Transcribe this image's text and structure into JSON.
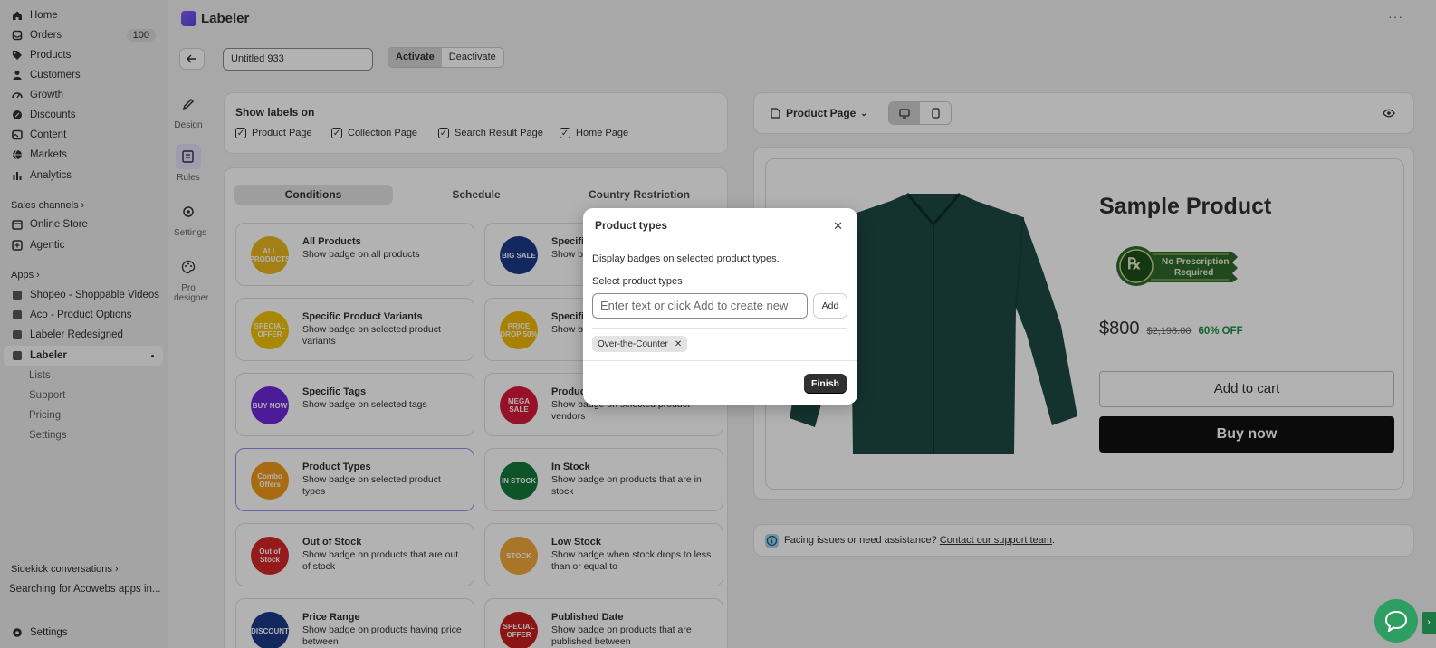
{
  "sidebar": {
    "items": [
      {
        "label": "Home",
        "icon": "home-icon"
      },
      {
        "label": "Orders",
        "icon": "orders-icon",
        "badge": "100"
      },
      {
        "label": "Products",
        "icon": "tag-icon"
      },
      {
        "label": "Customers",
        "icon": "person-icon"
      },
      {
        "label": "Growth",
        "icon": "gauge-icon"
      },
      {
        "label": "Discounts",
        "icon": "discount-icon"
      },
      {
        "label": "Content",
        "icon": "content-icon"
      },
      {
        "label": "Markets",
        "icon": "globe-icon"
      },
      {
        "label": "Analytics",
        "icon": "bar-chart-icon"
      }
    ],
    "sales_channels_label": "Sales channels",
    "channels": [
      {
        "label": "Online Store",
        "icon": "store-icon"
      },
      {
        "label": "Agentic",
        "icon": "agentic-icon"
      }
    ],
    "apps_label": "Apps",
    "apps": [
      {
        "label": "Shopeo - Shoppable Videos",
        "icon": "app-icon"
      },
      {
        "label": "Aco - Product Options",
        "icon": "app-icon"
      },
      {
        "label": "Labeler Redesigned",
        "icon": "app-icon"
      },
      {
        "label": "Labeler",
        "icon": "app-icon"
      }
    ],
    "labeler_sub": [
      "Lists",
      "Support",
      "Pricing",
      "Settings"
    ],
    "sidekick_label": "Sidekick conversations",
    "sidekick_item": "Searching for Acowebs apps in...",
    "settings_label": "Settings"
  },
  "header": {
    "app_title": "Labeler",
    "label_name": "Untitled 933",
    "activate_label": "Activate",
    "deactivate_label": "Deactivate"
  },
  "rail": [
    {
      "label": "Design",
      "icon": "pencil-icon"
    },
    {
      "label": "Rules",
      "icon": "rules-icon"
    },
    {
      "label": "Settings",
      "icon": "gear-icon"
    },
    {
      "label": "Pro designer",
      "icon": "palette-icon"
    }
  ],
  "show_labels": {
    "title": "Show labels on",
    "options": [
      "Product Page",
      "Collection Page",
      "Search Result Page",
      "Home Page"
    ]
  },
  "tabs": [
    "Conditions",
    "Schedule",
    "Country Restriction"
  ],
  "conditions": [
    {
      "title": "All Products",
      "desc": "Show badge on all products",
      "art": "ALL PRODUCTS",
      "color": "#e8b820"
    },
    {
      "title": "Specific Products",
      "desc": "Show badge on selected products",
      "art": "BIG SALE",
      "color": "#1e3a8a"
    },
    {
      "title": "Specific Product Variants",
      "desc": "Show badge on selected product variants",
      "art": "SPECIAL OFFER",
      "color": "#f2c200"
    },
    {
      "title": "Specific Collections",
      "desc": "Show badge on selected collections",
      "art": "PRICE DROP 50%",
      "color": "#f3b800"
    },
    {
      "title": "Specific Tags",
      "desc": "Show badge on selected tags",
      "art": "BUY NOW",
      "color": "#6d28d9"
    },
    {
      "title": "Product Vendors",
      "desc": "Show badge on selected product vendors",
      "art": "MEGA SALE",
      "color": "#d81b3a"
    },
    {
      "title": "Product Types",
      "desc": "Show badge on selected product types",
      "art": "Combo Offers",
      "color": "#f29a1a"
    },
    {
      "title": "In Stock",
      "desc": "Show badge on products that are in stock",
      "art": "IN STOCK",
      "color": "#137a3c"
    },
    {
      "title": "Out of Stock",
      "desc": "Show badge on products that are out of stock",
      "art": "Out of Stock",
      "color": "#d62828"
    },
    {
      "title": "Low Stock",
      "desc": "Show badge when stock drops to less than or equal to",
      "art": "STOCK",
      "color": "#f2a93b"
    },
    {
      "title": "Price Range",
      "desc": "Show badge on products having price between",
      "art": "DISCOUNT",
      "color": "#1e3a8a"
    },
    {
      "title": "Published Date",
      "desc": "Show badge on products that are published between",
      "art": "SPECIAL OFFER",
      "color": "#c81e1e"
    }
  ],
  "preview": {
    "page_select": "Product Page",
    "product_title": "Sample Product",
    "badge_text_1": "No Prescription",
    "badge_text_2": "Required",
    "price_now": "$800",
    "price_was": "$2,198.00",
    "discount": "60% OFF",
    "add_to_cart": "Add to cart",
    "buy_now": "Buy now"
  },
  "info": {
    "text": "Facing issues or need assistance?",
    "link": "Contact our support team",
    "suffix": "."
  },
  "modal": {
    "title": "Product types",
    "description": "Display badges on selected product types.",
    "field_label": "Select product types",
    "placeholder": "Enter text or click Add to create new",
    "add_label": "Add",
    "selected": [
      "Over-the-Counter"
    ],
    "finish_label": "Finish"
  }
}
